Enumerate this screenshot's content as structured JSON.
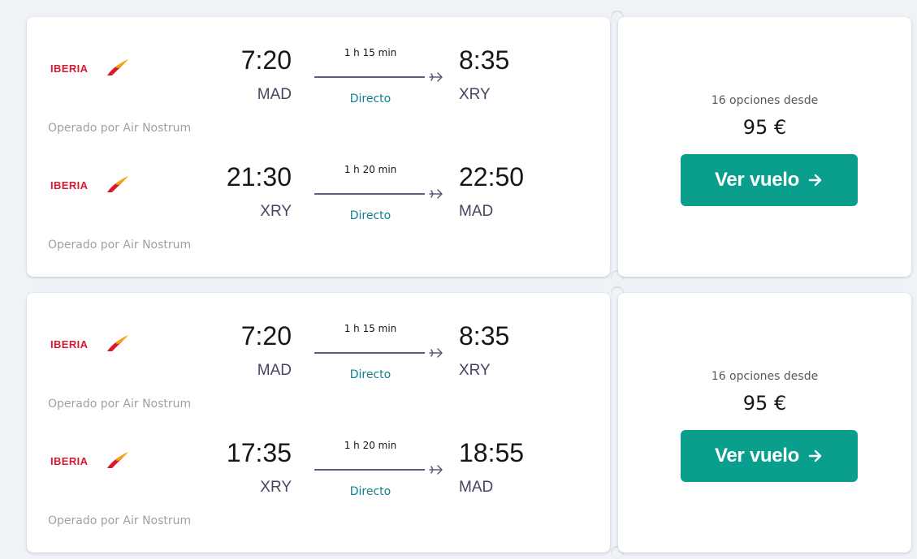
{
  "colors": {
    "page_background": "#eff3f8",
    "card_background": "#ffffff",
    "primary_text": "#161616",
    "airport_text": "#444560",
    "muted_text": "#9ea0a7",
    "direct_text": "#0c838a",
    "button_background": "#0a9e8d",
    "button_text": "#ffffff",
    "iberia_red": "#d7192d",
    "iberia_yellow": "#f6a800"
  },
  "results": [
    {
      "legs": [
        {
          "airline": "IBERIA",
          "airline_logo_icon": "iberia-logo-icon",
          "departure_time": "7:20",
          "departure_airport": "MAD",
          "duration": "1 h 15 min",
          "stops": "Directo",
          "arrival_time": "8:35",
          "arrival_airport": "XRY",
          "operator": "Operado por Air Nostrum"
        },
        {
          "airline": "IBERIA",
          "airline_logo_icon": "iberia-logo-icon",
          "departure_time": "21:30",
          "departure_airport": "XRY",
          "duration": "1 h 20 min",
          "stops": "Directo",
          "arrival_time": "22:50",
          "arrival_airport": "MAD",
          "operator": "Operado por Air Nostrum"
        }
      ],
      "options_text": "16 opciones desde",
      "price": "95 €",
      "button_label": "Ver vuelo",
      "button_icon": "arrow-right-icon"
    },
    {
      "legs": [
        {
          "airline": "IBERIA",
          "airline_logo_icon": "iberia-logo-icon",
          "departure_time": "7:20",
          "departure_airport": "MAD",
          "duration": "1 h 15 min",
          "stops": "Directo",
          "arrival_time": "8:35",
          "arrival_airport": "XRY",
          "operator": "Operado por Air Nostrum"
        },
        {
          "airline": "IBERIA",
          "airline_logo_icon": "iberia-logo-icon",
          "departure_time": "17:35",
          "departure_airport": "XRY",
          "duration": "1 h 20 min",
          "stops": "Directo",
          "arrival_time": "18:55",
          "arrival_airport": "MAD",
          "operator": "Operado por Air Nostrum"
        }
      ],
      "options_text": "16 opciones desde",
      "price": "95 €",
      "button_label": "Ver vuelo",
      "button_icon": "arrow-right-icon"
    }
  ]
}
